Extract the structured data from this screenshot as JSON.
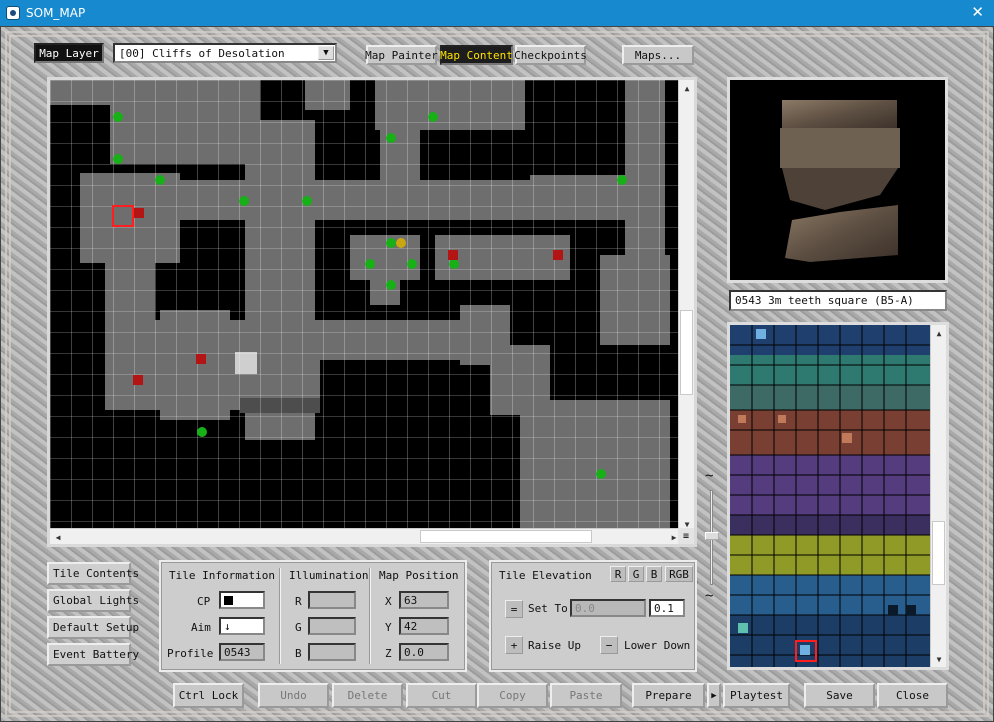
{
  "window": {
    "title": "SOM_MAP",
    "close_glyph": "✕"
  },
  "toolbar": {
    "map_layer_label": "Map Layer",
    "layer_select_value": "[00] Cliffs of Desolation",
    "tabs": [
      "Map Painter",
      "Map Content",
      "Checkpoints"
    ],
    "active_tab": "Map Content",
    "maps_button": "Maps..."
  },
  "map": {
    "grid_color": "#ffffff",
    "floor_color": "#6e6e6e",
    "marker_colors": {
      "green": "#17b017",
      "red": "#b31414",
      "yellow": "#c8a712"
    },
    "selection_color": "#ff1d1d"
  },
  "preview": {
    "tile_name": "0543 3m teeth square (B5-A)"
  },
  "side_buttons": [
    "Tile Contents",
    "Global Lights",
    "Default Setup",
    "Event Battery"
  ],
  "tile_info": {
    "heading": "Tile Information",
    "cp_label": "CP",
    "aim_label": "Aim",
    "aim_value": "↓",
    "profile_label": "Profile",
    "profile_value": "0543"
  },
  "illumination": {
    "heading": "Illumination",
    "r_label": "R",
    "g_label": "G",
    "b_label": "B"
  },
  "map_position": {
    "heading": "Map Position",
    "x_label": "X",
    "x_value": "63",
    "y_label": "Y",
    "y_value": "42",
    "z_label": "Z",
    "z_value": "0.0"
  },
  "elevation": {
    "heading": "Tile Elevation",
    "rgb_buttons": [
      "R",
      "G",
      "B",
      "RGB"
    ],
    "set_to_label": "Set To",
    "set_to_value": "0.0",
    "step_value": "0.1",
    "raise_label": "Raise Up",
    "lower_label": "Lower Down",
    "equals_glyph": "=",
    "plus_glyph": "+",
    "minus_glyph": "−"
  },
  "bottom_buttons": {
    "ctrl_lock": "Ctrl Lock",
    "undo": "Undo",
    "delete": "Delete",
    "cut": "Cut",
    "copy": "Copy",
    "paste": "Paste",
    "prepare": "Prepare",
    "play_arrow": "▶",
    "playtest": "Playtest",
    "save": "Save",
    "close": "Close"
  },
  "slider_marks": {
    "top": "~",
    "bottom": "~"
  }
}
